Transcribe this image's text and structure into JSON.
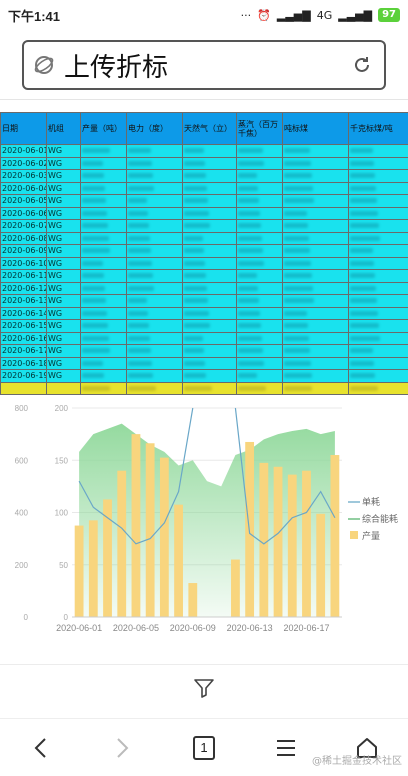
{
  "status": {
    "time": "下午1:41",
    "network": "4G",
    "battery": "97"
  },
  "urlbar": {
    "title": "上传折标"
  },
  "table": {
    "headers": [
      "日期",
      "机组",
      "产量（吨）",
      "电力（度）",
      "天然气（立）",
      "蒸汽（百万千焦）",
      "吨标煤",
      "千克标煤/吨"
    ],
    "rows": [
      {
        "date": "2020-06-01",
        "unit": "WG"
      },
      {
        "date": "2020-06-02",
        "unit": "WG"
      },
      {
        "date": "2020-06-03",
        "unit": "WG"
      },
      {
        "date": "2020-06-04",
        "unit": "WG"
      },
      {
        "date": "2020-06-05",
        "unit": "WG"
      },
      {
        "date": "2020-06-06",
        "unit": "WG"
      },
      {
        "date": "2020-06-07",
        "unit": "WG"
      },
      {
        "date": "2020-06-08",
        "unit": "WG"
      },
      {
        "date": "2020-06-09",
        "unit": "WG"
      },
      {
        "date": "2020-06-10",
        "unit": "WG"
      },
      {
        "date": "2020-06-11",
        "unit": "WG"
      },
      {
        "date": "2020-06-12",
        "unit": "WG"
      },
      {
        "date": "2020-06-13",
        "unit": "WG"
      },
      {
        "date": "2020-06-14",
        "unit": "WG"
      },
      {
        "date": "2020-06-15",
        "unit": "WG"
      },
      {
        "date": "2020-06-16",
        "unit": "WG"
      },
      {
        "date": "2020-06-17",
        "unit": "WG"
      },
      {
        "date": "2020-06-18",
        "unit": "WG"
      },
      {
        "date": "2020-06-19",
        "unit": "WG"
      }
    ]
  },
  "chart_data": {
    "type": "bar",
    "x": [
      "2020-06-01",
      "2020-06-02",
      "2020-06-03",
      "2020-06-04",
      "2020-06-05",
      "2020-06-06",
      "2020-06-07",
      "2020-06-08",
      "2020-06-09",
      "2020-06-10",
      "2020-06-11",
      "2020-06-12",
      "2020-06-13",
      "2020-06-14",
      "2020-06-15",
      "2020-06-16",
      "2020-06-17",
      "2020-06-18",
      "2020-06-19"
    ],
    "xtick_labels": [
      "2020-06-01",
      "2020-06-05",
      "2020-06-09",
      "2020-06-13",
      "2020-06-17"
    ],
    "left_ticks": [
      "800",
      "600",
      "400",
      "200",
      "0"
    ],
    "right_ticks": [
      "200",
      "150",
      "100",
      "50",
      "0"
    ],
    "series": [
      {
        "name": "产量",
        "type": "bar",
        "values": [
          350,
          370,
          450,
          560,
          700,
          665,
          610,
          430,
          130,
          0,
          0,
          220,
          670,
          590,
          575,
          545,
          560,
          395,
          620
        ]
      },
      {
        "name": "综合能耗",
        "type": "area",
        "values": [
          158,
          175,
          180,
          185,
          175,
          165,
          158,
          145,
          150,
          130,
          125,
          155,
          160,
          170,
          175,
          178,
          180,
          175,
          178
        ]
      },
      {
        "name": "单耗",
        "type": "line",
        "values": [
          130,
          105,
          95,
          85,
          70,
          75,
          90,
          120,
          200,
          null,
          null,
          200,
          80,
          70,
          80,
          95,
          100,
          120,
          95
        ]
      }
    ],
    "legend": [
      "单耗",
      "综合能耗",
      "产量"
    ],
    "colors": {
      "bar": "#f8d57e",
      "area": "#8fd89a",
      "line": "#6aa7c8",
      "legend_single": "#7fb6cf",
      "legend_total": "#6fbf83"
    }
  },
  "nav": {
    "tab_count": "1"
  },
  "watermark": "@稀土掘金技术社区"
}
